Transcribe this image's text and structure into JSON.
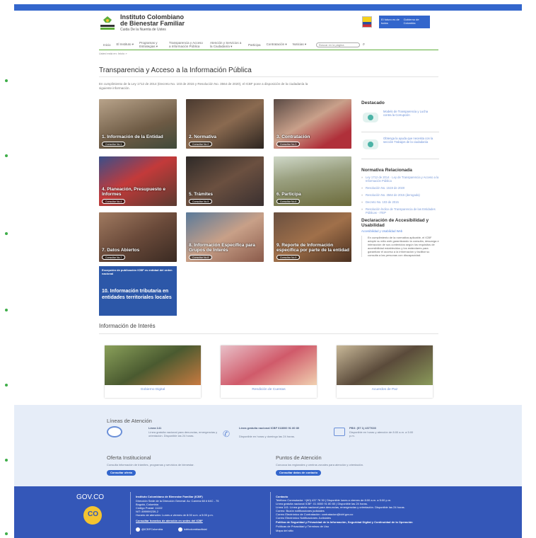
{
  "header": {
    "brand_line1": "Instituto Colombiano",
    "brand_line2": "de Bienestar Familiar",
    "tagline": "Cuida De la Nuenta de Ustes",
    "gov_left": "El futuro es de todos",
    "gov_right": "Gobierno de Colombia",
    "nav": [
      "Inicio",
      "El Instituto ▾",
      "Programas y Estrategias ▾",
      "Transparencia y Acceso a Información Pública",
      "Atención y Servicios a la Ciudadanía ▾",
      "Participa",
      "Contratación ▾",
      "Noticias ▾"
    ],
    "search_placeholder": "Buscar en la página",
    "breadcrumb": "Usted está en:   Inicio »"
  },
  "page": {
    "title": "Transparencia y Acceso a la Información Pública",
    "intro": "En cumplimiento de la Ley 1712 de 2014 (Decreto No. 103 de 2015 y Resolución No. 3564 de 2020), el ICBF pone a disposición de la ciudadanía la siguiente información."
  },
  "cards": [
    {
      "title": "1. Información de la Entidad",
      "button": "Consultar No.1"
    },
    {
      "title": "2. Normativa",
      "button": "Consultar No.2"
    },
    {
      "title": "3. Contratación",
      "button": "Consultar No.3"
    },
    {
      "title": "4. Planeación, Presupuesto e Informes",
      "button": "Consultar No.4"
    },
    {
      "title": "5. Trámites",
      "button": "Consultar No.5"
    },
    {
      "title": "6. Participa",
      "button": "Consultar No.6"
    },
    {
      "title": "7. Datos Abiertos",
      "button": "Consultar No.7"
    },
    {
      "title": "8. Información Específica para Grupos de Interés",
      "button": "Consultar No.8"
    },
    {
      "title": "9. Reporte de Información específica por parte de la entidad",
      "button": "Consultar No.9"
    }
  ],
  "card10": {
    "subtitle": "Excepción de publicación ICBF es entidad del orden nacional",
    "title": "10. Información tributaria en entidades territoriales locales"
  },
  "sidebar": {
    "destacado": "Destacado",
    "promo1": "Modelo de Transparencia y Lucha contra la Corrupción",
    "promo2": "Obtenga la ayuda que necesita con la sección Trabajos de la ciudadanía",
    "normativa_title": "Normativa Relacionada",
    "normativa": [
      "Ley 1712 de 2014 · Ley de Transparencia y Acceso a la Información Pública",
      "Resolución No. 1519 de 2020",
      "Resolución No. 3564 de 2015 (derogada)",
      "Decreto No. 103 de 2015",
      "Resolución Índice de Transparencia de las Entidades Públicas - ITEP"
    ],
    "decl_title": "Declaración de Accesibilidad y Usabilidad",
    "decl_sub": "Accesibilidad y Usabilidad Web",
    "decl_body": "En cumplimiento de la normativa aplicable, el ICBF adoptó su sitio web garantizando la consulta, descarga e interacción de sus contenidos según los requisitos de accesibilidad establecidos y los estándares para garantizar el acceso a la información y facilitar su consulta a las personas con discapacidad."
  },
  "interes": {
    "title": "Información de Interés",
    "items": [
      "Gobierno Digital",
      "Rendición de Cuentas",
      "Acuerdos de Paz"
    ]
  },
  "footer": {
    "lineas_title": "Líneas de Atención",
    "l141_title": "Línea 141",
    "l141_text": "Línea gratuita nacional para denuncias, emergencias y orientación. Disponible las 24 horas.",
    "lnac_title": "Línea gratuita nacional ICBF 018000 91 80 80",
    "lnac_text": "Disponible en horas y domingo las 24 horas.",
    "pbx_title": "PBX: (57 1) 4377630",
    "pbx_text": "Disponible en horas y atención de 8:00 a.m. a 5:00 p.m.",
    "oferta_title": "Oferta Institucional",
    "oferta_text": "Consulta información de trámites, programas y servicios de bienestar.",
    "oferta_btn": "Consultar oferta",
    "puntos_title": "Puntos de Atención",
    "puntos_text": "Conozca los regionales y centros zonales para atención y orientación.",
    "puntos_btn": "Consultar datos de contacto",
    "govco": "GOV.CO",
    "inst_title": "Instituto Colombiano de Bienestar Familiar (ICBF)",
    "inst_lines": [
      "Dirección Sede de la Dirección General: Av. Carrera 68 # 64C - 75",
      "Bogotá, Colombia",
      "Código Postal: 11102",
      "NIT: 899999239-2",
      "Horario de atención: Lunes a viernes de 8:00 a.m. a 5:00 p.m."
    ],
    "inst_link": "Consultar horarios de atención en sedes del ICBF",
    "social1": "@ICBFColombia",
    "social2": "icbfcolombiaoficial",
    "contacto_title": "Contacto",
    "contacto_lines": [
      "Teléfono Conmutador: +(60) 437 76 30 | Disponible lunes a viernes de 8:00 a.m. a 5:00 p.m.",
      "Línea gratuita nacional ICBF: 01 8000 91 80 80 | Disponible las 24 horas.",
      "Línea 141: Línea gratuita nacional para denuncias, emergencias y orientación. Disponible las 24 horas.",
      "Correo: Buzón notificaciones judiciales",
      "Correo Electrónico de Contratación: contratacion@icbf.gov.co",
      "Correo Electrónico Notificaciones Judiciales",
      "Política de Seguridad y Privacidad de la Información, Seguridad Digital y Continuidad de la Operación",
      "Políticas de Privacidad y Términos de Uso",
      "Mapa del sitio"
    ]
  },
  "colors": {
    "brand": "#3366cc",
    "green": "#5fae3b",
    "footer_light": "#e6edf8",
    "footer_dark": "#3457b8"
  }
}
